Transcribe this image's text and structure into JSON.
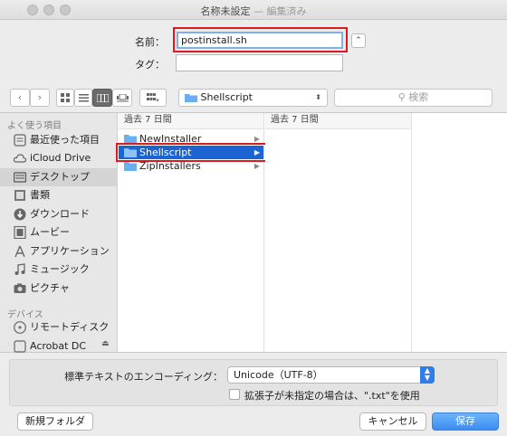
{
  "window": {
    "title": "名称未設定",
    "title_suffix": " — 編集済み"
  },
  "save_form": {
    "name_label": "名前：",
    "name_value": "postinstall.sh",
    "tags_label": "タグ：",
    "tags_value": ""
  },
  "toolbar": {
    "back_icon": "chevron-left",
    "forward_icon": "chevron-right",
    "location": "Shellscript",
    "search_placeholder": "検索"
  },
  "sidebar": {
    "favorites_heading": "よく使う項目",
    "favorites": [
      {
        "label": "最近使った項目",
        "icon": "recent-icon"
      },
      {
        "label": "iCloud Drive",
        "icon": "cloud-icon"
      },
      {
        "label": "デスクトップ",
        "icon": "desktop-icon",
        "selected": true
      },
      {
        "label": "書類",
        "icon": "documents-icon"
      },
      {
        "label": "ダウンロード",
        "icon": "download-icon"
      },
      {
        "label": "ムービー",
        "icon": "movie-icon"
      },
      {
        "label": "アプリケーション",
        "icon": "applications-icon"
      },
      {
        "label": "ミュージック",
        "icon": "music-icon"
      },
      {
        "label": "ピクチャ",
        "icon": "camera-icon"
      }
    ],
    "devices_heading": "デバイス",
    "devices": [
      {
        "label": "リモートディスク",
        "icon": "remote-disc-icon"
      },
      {
        "label": "Acrobat DC",
        "icon": "disk-image-icon"
      }
    ]
  },
  "columns": [
    {
      "header": "過去 7 日間",
      "items": [
        {
          "label": "NewInstaller",
          "selected": false
        },
        {
          "label": "Shellscript",
          "selected": true
        },
        {
          "label": "ZipInstallers",
          "selected": false
        }
      ]
    },
    {
      "header": "過去 7 日間",
      "items": []
    }
  ],
  "options": {
    "encoding_label": "標準テキストのエンコーディング：",
    "encoding_value": "Unicode（UTF-8）",
    "extension_checkbox_label": "拡張子が未指定の場合は、\".txt\"を使用",
    "extension_checked": false
  },
  "buttons": {
    "new_folder": "新規フォルダ",
    "cancel": "キャンセル",
    "save": "保存"
  },
  "colors": {
    "accent": "#1c64d4",
    "highlight_outline": "#d81b20",
    "folder": "#6ab0f0"
  }
}
